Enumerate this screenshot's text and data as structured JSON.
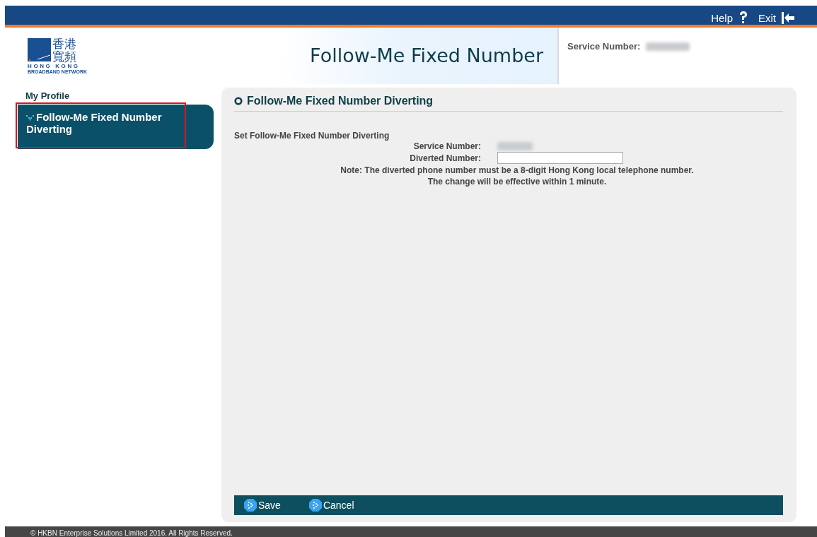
{
  "top_bar": {
    "links": [
      {
        "label": "Help",
        "kind": "help"
      },
      {
        "label": "Exit",
        "kind": "exit"
      }
    ]
  },
  "logo": {
    "chinese": "香港寬頻",
    "english": "HONG KONG",
    "subtitle": "BROADBAND NETWORK"
  },
  "banner": {
    "title": "Follow-Me Fixed Number"
  },
  "header_info": {
    "label": "Service Number:"
  },
  "sidebar": {
    "heading": "My Profile",
    "items": [
      {
        "label": "Follow-Me Fixed Number Diverting",
        "selected": true,
        "highlighted": true
      }
    ]
  },
  "panel": {
    "title": "Follow-Me Fixed Number Diverting",
    "subtitle": "Set Follow-Me Fixed Number Diverting",
    "fields": [
      {
        "label": "Service Number:",
        "kind": "text"
      },
      {
        "label": "Diverted Number:",
        "kind": "input"
      }
    ],
    "notes": [
      "Note: The diverted phone number must be a 8-digit Hong Kong local telephone number.",
      "The change will be effective within 1 minute."
    ],
    "actions": [
      "Save",
      "Cancel"
    ]
  },
  "footer": {
    "text": "© HKBN Enterprise Solutions Limited 2016. All Rights Reserved."
  }
}
